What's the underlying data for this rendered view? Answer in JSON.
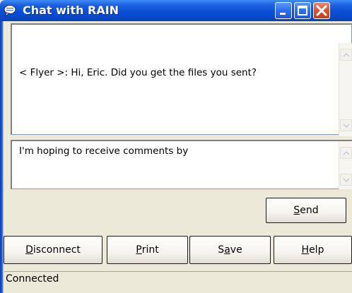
{
  "window": {
    "title": "Chat with RAIN",
    "colors": {
      "titlebar": "#0a4ed6",
      "close": "#d55533",
      "face": "#ece9d8"
    }
  },
  "chat": {
    "history_text": "< Flyer >:  Hi, Eric. Did you get the files you sent?",
    "input_text": "I'm hoping to receive comments by"
  },
  "buttons": {
    "send": {
      "pre": "",
      "acc": "S",
      "post": "end"
    },
    "disconnect": {
      "pre": "",
      "acc": "D",
      "post": "isconnect"
    },
    "print": {
      "pre": "",
      "acc": "P",
      "post": "rint"
    },
    "save": {
      "pre": "S",
      "acc": "a",
      "post": "ve"
    },
    "help": {
      "pre": "",
      "acc": "H",
      "post": "elp"
    }
  },
  "status": {
    "text": "Connected"
  },
  "icons": [
    "chat-bubble-icon",
    "minimize-icon",
    "maximize-icon",
    "close-icon",
    "scroll-up-arrow-icon",
    "scroll-down-arrow-icon"
  ]
}
